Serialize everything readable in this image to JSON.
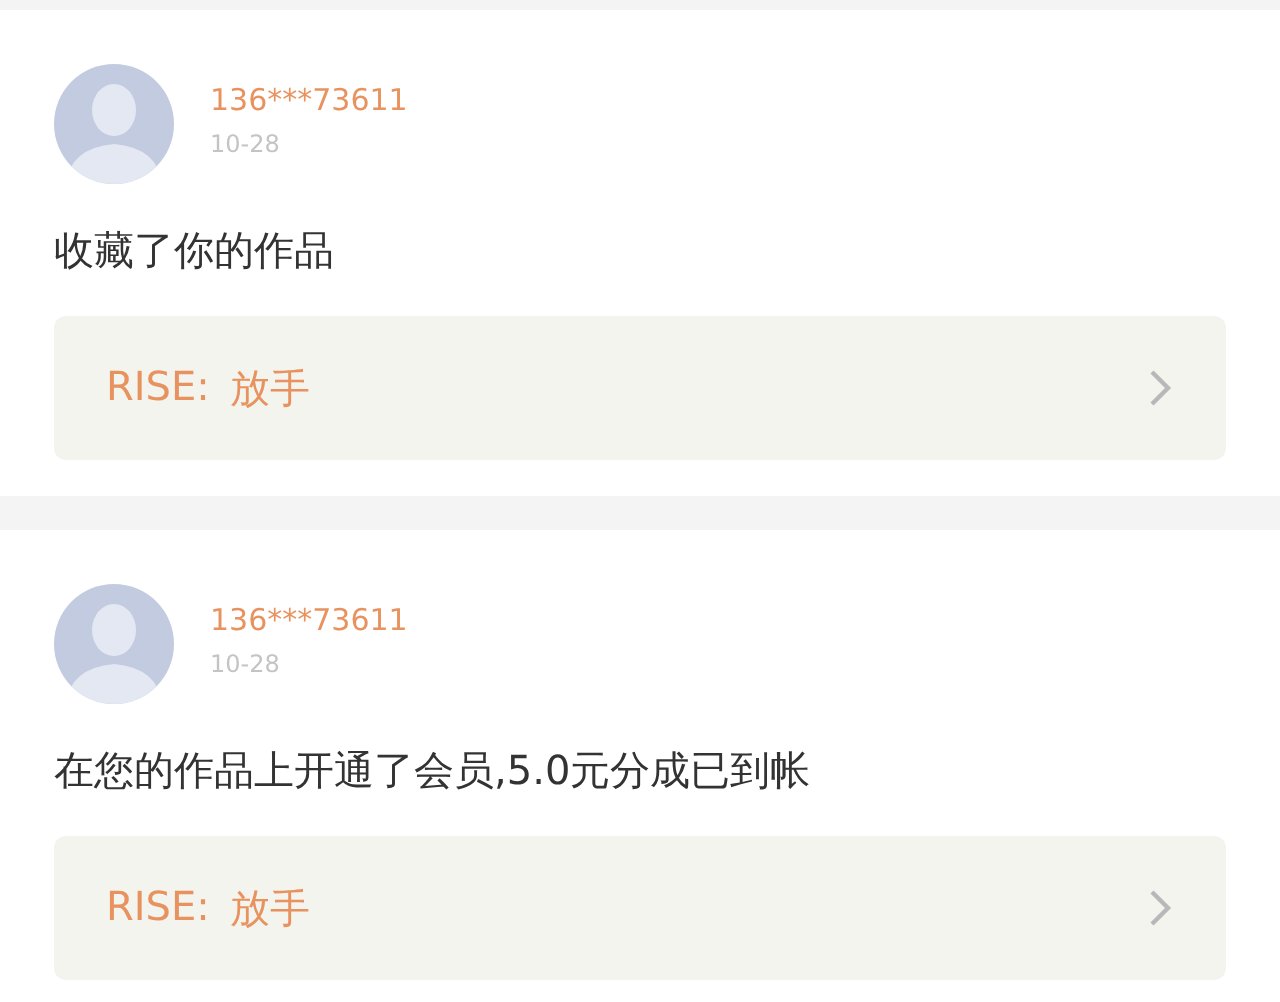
{
  "notifications": [
    {
      "user": "136***73611",
      "date": "10-28",
      "message": "收藏了你的作品",
      "work": {
        "label": "RISE:",
        "title": "放手"
      }
    },
    {
      "user": "136***73611",
      "date": "10-28",
      "message": "在您的作品上开通了会员,5.0元分成已到帐",
      "work": {
        "label": "RISE:",
        "title": "放手"
      }
    }
  ]
}
